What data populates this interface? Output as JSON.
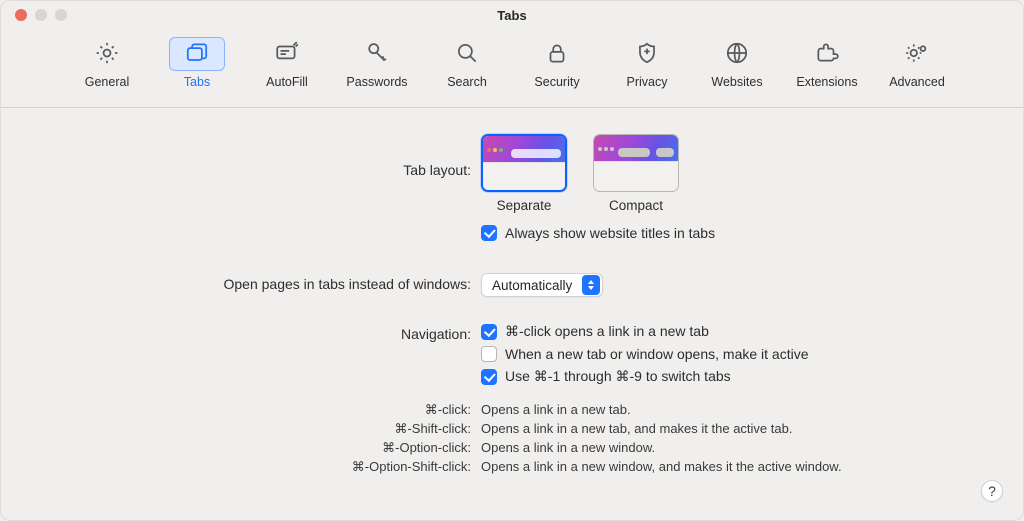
{
  "window": {
    "title": "Tabs"
  },
  "toolbar": {
    "items": [
      {
        "id": "general",
        "label": "General"
      },
      {
        "id": "tabs",
        "label": "Tabs"
      },
      {
        "id": "autofill",
        "label": "AutoFill"
      },
      {
        "id": "passwords",
        "label": "Passwords"
      },
      {
        "id": "search",
        "label": "Search"
      },
      {
        "id": "security",
        "label": "Security"
      },
      {
        "id": "privacy",
        "label": "Privacy"
      },
      {
        "id": "websites",
        "label": "Websites"
      },
      {
        "id": "extensions",
        "label": "Extensions"
      },
      {
        "id": "advanced",
        "label": "Advanced"
      }
    ],
    "selected": "tabs"
  },
  "sections": {
    "tab_layout": {
      "label": "Tab layout:",
      "options": {
        "separate": "Separate",
        "compact": "Compact"
      },
      "always_show_titles": {
        "label": "Always show website titles in tabs",
        "checked": true
      }
    },
    "open_pages": {
      "label": "Open pages in tabs instead of windows:",
      "value": "Automatically"
    },
    "navigation": {
      "label": "Navigation:",
      "cmd_click": {
        "label": "⌘-click opens a link in a new tab",
        "checked": true
      },
      "make_active": {
        "label": "When a new tab or window opens, make it active",
        "checked": false
      },
      "use_cmd_numbers": {
        "label": "Use ⌘-1 through ⌘-9 to switch tabs",
        "checked": true
      }
    },
    "hints": [
      {
        "key": "⌘-click:",
        "desc": "Opens a link in a new tab."
      },
      {
        "key": "⌘-Shift-click:",
        "desc": "Opens a link in a new tab, and makes it the active tab."
      },
      {
        "key": "⌘-Option-click:",
        "desc": "Opens a link in a new window."
      },
      {
        "key": "⌘-Option-Shift-click:",
        "desc": "Opens a link in a new window, and makes it the active window."
      }
    ]
  },
  "help": "?"
}
